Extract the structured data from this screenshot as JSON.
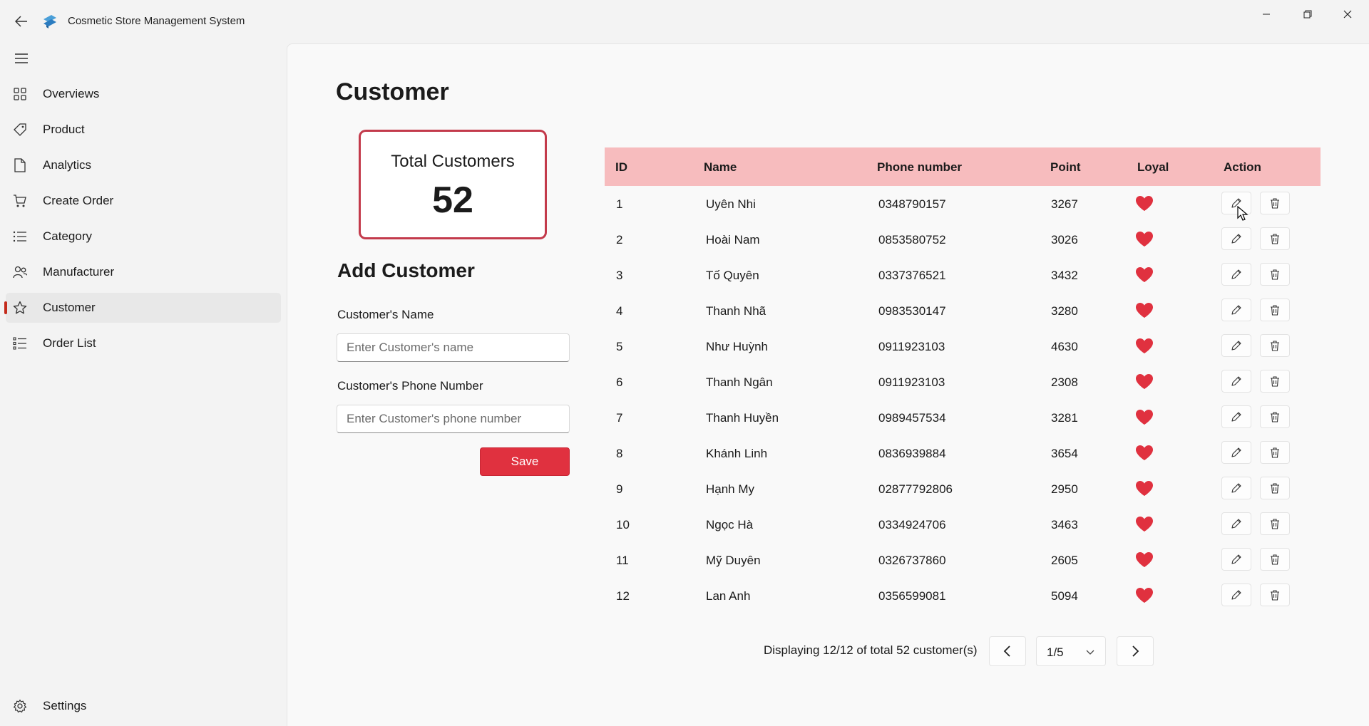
{
  "window": {
    "title": "Cosmetic Store Management System"
  },
  "sidebar": {
    "items": [
      {
        "label": "Overviews",
        "icon": "grid-icon"
      },
      {
        "label": "Product",
        "icon": "tag-icon"
      },
      {
        "label": "Analytics",
        "icon": "document-icon"
      },
      {
        "label": "Create Order",
        "icon": "cart-icon"
      },
      {
        "label": "Category",
        "icon": "list-icon"
      },
      {
        "label": "Manufacturer",
        "icon": "people-icon"
      },
      {
        "label": "Customer",
        "icon": "star-icon",
        "active": true
      },
      {
        "label": "Order List",
        "icon": "checklist-icon"
      }
    ],
    "settings_label": "Settings"
  },
  "page": {
    "title": "Customer",
    "total_card": {
      "label": "Total Customers",
      "value": "52"
    },
    "add_form": {
      "title": "Add Customer",
      "name_label": "Customer's Name",
      "name_placeholder": "Enter Customer's name",
      "phone_label": "Customer's Phone Number",
      "phone_placeholder": "Enter Customer's phone number",
      "save_label": "Save"
    }
  },
  "table": {
    "headers": {
      "id": "ID",
      "name": "Name",
      "phone": "Phone number",
      "point": "Point",
      "loyal": "Loyal",
      "action": "Action"
    },
    "rows": [
      {
        "id": "1",
        "name": "Uyên Nhi",
        "phone": "0348790157",
        "point": "3267"
      },
      {
        "id": "2",
        "name": "Hoài Nam",
        "phone": "0853580752",
        "point": "3026"
      },
      {
        "id": "3",
        "name": "Tố Quyên",
        "phone": "0337376521",
        "point": "3432"
      },
      {
        "id": "4",
        "name": "Thanh Nhã",
        "phone": "0983530147",
        "point": "3280"
      },
      {
        "id": "5",
        "name": "Như Huỳnh",
        "phone": "0911923103",
        "point": "4630"
      },
      {
        "id": "6",
        "name": "Thanh Ngân",
        "phone": "0911923103",
        "point": "2308"
      },
      {
        "id": "7",
        "name": "Thanh Huyền",
        "phone": "0989457534",
        "point": "3281"
      },
      {
        "id": "8",
        "name": "Khánh Linh",
        "phone": "0836939884",
        "point": "3654"
      },
      {
        "id": "9",
        "name": "Hạnh My",
        "phone": "02877792806",
        "point": "2950"
      },
      {
        "id": "10",
        "name": "Ngọc Hà",
        "phone": "0334924706",
        "point": "3463"
      },
      {
        "id": "11",
        "name": "Mỹ Duyên",
        "phone": "0326737860",
        "point": "2605"
      },
      {
        "id": "12",
        "name": "Lan Anh",
        "phone": "0356599081",
        "point": "5094"
      }
    ]
  },
  "pagination": {
    "summary": "Displaying 12/12 of total 52 customer(s)",
    "current_page": "1/5"
  },
  "colors": {
    "accent": "#e0313f",
    "card_border": "#c33a4b",
    "table_header": "#f7bcbe",
    "heart": "#e0313f"
  }
}
